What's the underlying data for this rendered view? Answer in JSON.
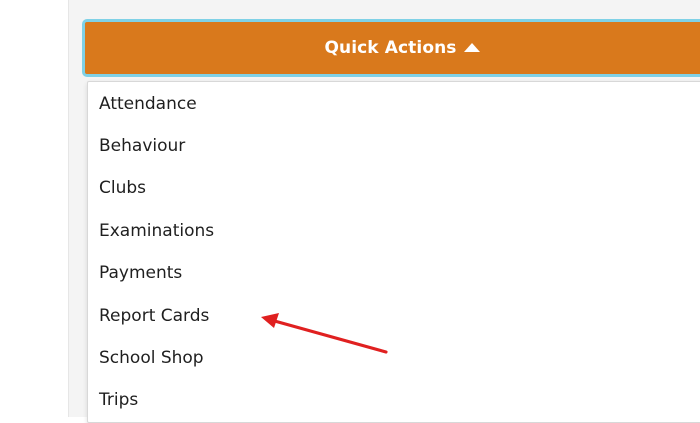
{
  "quick_actions": {
    "label": "Quick Actions",
    "caret_icon": "caret-up-icon",
    "bg_color": "#d9791c",
    "border_color": "#7fd1e6"
  },
  "menu": {
    "items": [
      {
        "label": "Attendance"
      },
      {
        "label": "Behaviour"
      },
      {
        "label": "Clubs"
      },
      {
        "label": "Examinations"
      },
      {
        "label": "Payments"
      },
      {
        "label": "Report Cards"
      },
      {
        "label": "School Shop"
      },
      {
        "label": "Trips"
      }
    ]
  },
  "annotation": {
    "color": "#e02020",
    "icon": "red-arrow-annotation",
    "points_to": "Report Cards"
  }
}
